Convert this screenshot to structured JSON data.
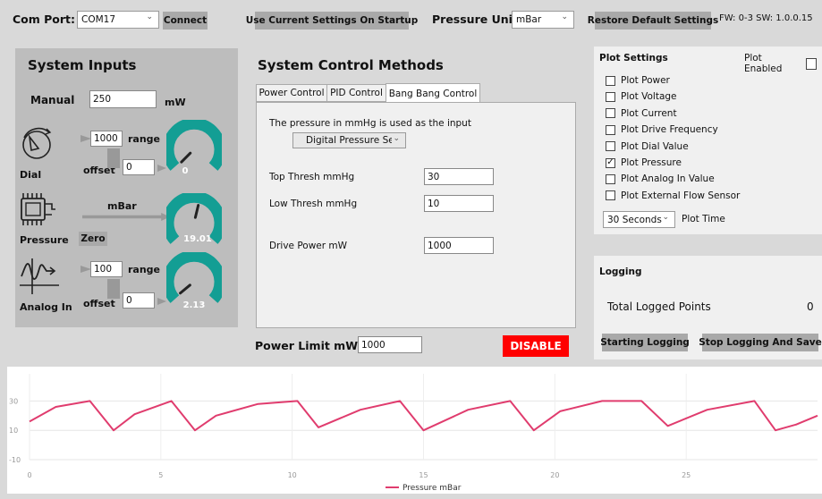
{
  "header": {
    "com_port_label": "Com Port:",
    "com_port_value": "COM17",
    "connect_label": "Connect",
    "use_current_label": "Use Current Settings On Startup",
    "pressure_unit_label": "Pressure Unit",
    "pressure_unit_value": "mBar",
    "restore_label": "Restore Default Settings",
    "fw_sw": "FW: 0-3   SW: 1.0.0.15"
  },
  "system_inputs": {
    "title": "System Inputs",
    "manual_label": "Manual",
    "manual_value": "250",
    "manual_unit": "mW",
    "dial": {
      "label": "Dial",
      "range_value": "1000",
      "range_label": "range",
      "offset_label": "offset",
      "offset_value": "0",
      "gauge_value": "0",
      "gauge_fraction": 0.0
    },
    "pressure": {
      "label": "Pressure",
      "unit": "mBar",
      "zero_label": "Zero",
      "gauge_value": "19.01",
      "gauge_fraction": 0.55
    },
    "analog": {
      "label": "Analog In",
      "range_value": "100",
      "range_label": "range",
      "offset_label": "offset",
      "offset_value": "0",
      "gauge_value": "2.13",
      "gauge_fraction": 0.02
    }
  },
  "control": {
    "title": "System Control Methods",
    "tabs": [
      "Power Control",
      "PID Control",
      "Bang Bang Control"
    ],
    "active_tab": 2,
    "input_text": "The pressure in mmHg is used as the input",
    "sensor_select": "Digital Pressure Sensor",
    "top_thresh_label": "Top Thresh mmHg",
    "top_thresh_value": "30",
    "low_thresh_label": "Low Thresh mmHg",
    "low_thresh_value": "10",
    "drive_power_label": "Drive Power mW",
    "drive_power_value": "1000",
    "power_limit_label": "Power Limit mW",
    "power_limit_value": "1000",
    "disable_label": "DISABLE",
    "disable_color": "#ff0000"
  },
  "plot_settings": {
    "title": "Plot Settings",
    "plot_enabled_label": "Plot Enabled",
    "plot_enabled": false,
    "items": [
      {
        "label": "Plot Power",
        "checked": false
      },
      {
        "label": "Plot Voltage",
        "checked": false
      },
      {
        "label": "Plot Current",
        "checked": false
      },
      {
        "label": "Plot Drive Frequency",
        "checked": false
      },
      {
        "label": "Plot Dial Value",
        "checked": false
      },
      {
        "label": "Plot Pressure",
        "checked": true
      },
      {
        "label": "Plot Analog In Value",
        "checked": false
      },
      {
        "label": "Plot External Flow Sensor",
        "checked": false
      }
    ],
    "plot_time_value": "30 Seconds",
    "plot_time_label": "Plot Time"
  },
  "logging": {
    "title": "Logging",
    "total_label": "Total Logged Points",
    "total_value": "0",
    "start_label": "Starting Logging",
    "stop_label": "Stop Logging And Save"
  },
  "colors": {
    "gauge_teal": "#139e94",
    "series_pink": "#e03c6e",
    "panel_gray": "#bdbdbd"
  },
  "chart_data": {
    "type": "line",
    "xlim": [
      0,
      30
    ],
    "ylim": [
      -10,
      40
    ],
    "x_ticks": [
      "0",
      "5",
      "10",
      "15",
      "20",
      "25"
    ],
    "y_ticks": [
      "30",
      "10",
      "-10"
    ],
    "series": [
      {
        "name": "Pressure mBar",
        "color": "#e03c6e",
        "x": [
          0,
          1.0,
          2.3,
          3.2,
          4.0,
          5.4,
          6.3,
          7.1,
          8.7,
          10.2,
          11.0,
          12.6,
          14.1,
          15.0,
          16.7,
          18.3,
          19.2,
          20.2,
          21.8,
          23.3,
          24.3,
          25.8,
          27.6,
          28.4,
          29.2,
          30
        ],
        "y": [
          16,
          26,
          30,
          10,
          21,
          30,
          10,
          20,
          28,
          30,
          12,
          24,
          30,
          10,
          24,
          30,
          10,
          23,
          30,
          30,
          13,
          24,
          30,
          10,
          14,
          20
        ]
      }
    ]
  }
}
